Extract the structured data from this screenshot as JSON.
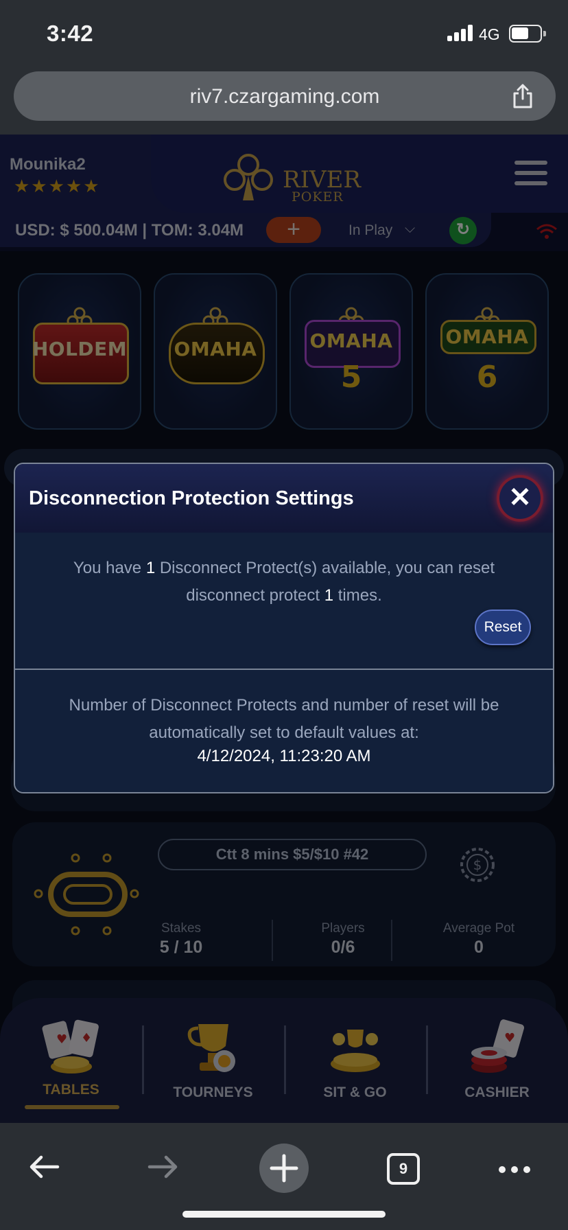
{
  "status_bar": {
    "time": "3:42",
    "network": "4G"
  },
  "browser": {
    "url": "riv7.czargaming.com",
    "tab_count": "9"
  },
  "header": {
    "username": "Mounika2",
    "stars": "★★★★★",
    "logo_text": "RIVER",
    "logo_sub": "POKER",
    "balance": "USD: $ 500.04M | TOM: 3.04M",
    "add_label": "+",
    "filter": "In Play"
  },
  "games": [
    {
      "label": "HOLDEM",
      "num": ""
    },
    {
      "label": "OMAHA",
      "num": ""
    },
    {
      "label": "OMAHA",
      "num": "5"
    },
    {
      "label": "OMAHA",
      "num": "6"
    }
  ],
  "modal": {
    "title": "Disconnection Protection Settings",
    "close": "✕",
    "msg_a": "You have ",
    "protects": "1",
    "msg_b": " Disconnect Protect(s) available, you can reset disconnect protect ",
    "resets": "1",
    "msg_c": " times.",
    "reset_label": "Reset",
    "footer_text": "Number of Disconnect Protects and number of reset will be automatically set to default values at:",
    "footer_date": "4/12/2024, 11:23:20 AM"
  },
  "table_card": {
    "name": "Ctt 8 mins $5/$10 #42",
    "stakes_label": "Stakes",
    "stakes": "5 / 10",
    "players_label": "Players",
    "players": "0/6",
    "avg_pot_label": "Average Pot",
    "avg_pot": "0"
  },
  "bottom_nav": [
    "TABLES",
    "TOURNEYS",
    "SIT & GO",
    "CASHIER"
  ],
  "colors": {
    "accent_gold": "#c9a24a",
    "modal_bg": "#12203a",
    "reset_blue": "#233b7d",
    "close_glow": "#be1e37"
  }
}
